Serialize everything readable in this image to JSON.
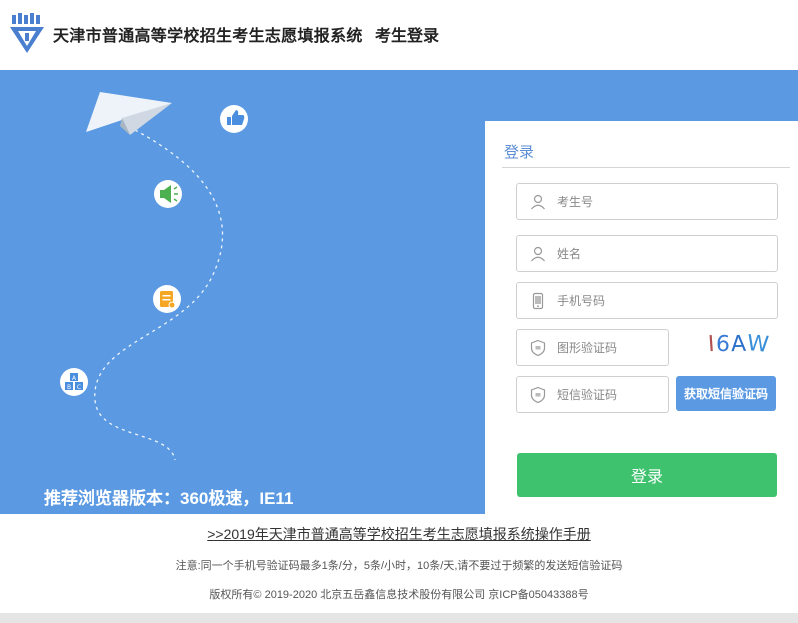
{
  "header": {
    "title": "天津市普通高等学校招生考生志愿填报系统",
    "subtitle": "考生登录"
  },
  "hero": {
    "browser_tip": "推荐浏览器版本：360极速，IE11",
    "icons": [
      "paper-plane-icon",
      "thumbs-up-icon",
      "megaphone-icon",
      "document-icon",
      "abc-blocks-icon"
    ]
  },
  "login": {
    "title": "登录",
    "fields": {
      "exam_no": {
        "placeholder": "考生号",
        "value": ""
      },
      "name": {
        "placeholder": "姓名",
        "value": ""
      },
      "phone": {
        "placeholder": "手机号码",
        "value": ""
      },
      "image_code": {
        "placeholder": "图形验证码",
        "value": ""
      },
      "sms_code": {
        "placeholder": "短信验证码",
        "value": ""
      }
    },
    "captcha_text": "I6AW",
    "sms_button": "获取短信验证码",
    "submit_button": "登录"
  },
  "footer": {
    "manual_link": ">>2019年天津市普通高等学校招生考生志愿填报系统操作手册",
    "notice": "注意:同一个手机号验证码最多1条/分，5条/小时，10条/天,请不要过于频繁的发送短信验证码",
    "copyright": "版权所有© 2019-2020 北京五岳鑫信息技术股份有限公司 京ICP备05043388号"
  },
  "colors": {
    "hero_bg": "#5b9ae3",
    "login_button": "#3ec26e",
    "sms_button": "#5b9ae3",
    "logo": "#4a7fd0"
  }
}
